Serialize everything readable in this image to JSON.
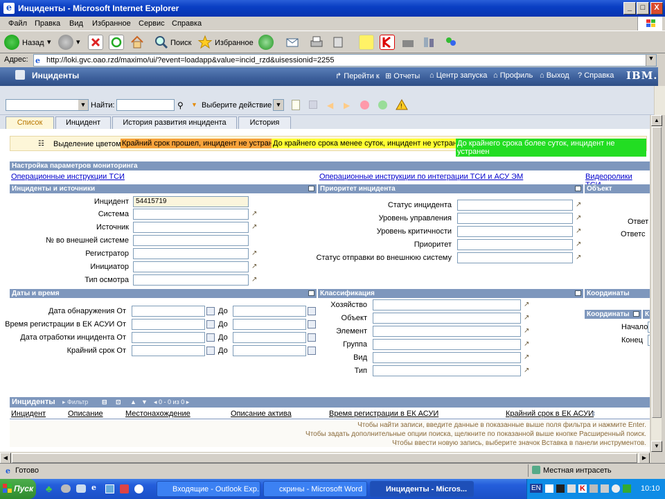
{
  "window": {
    "title": "Инциденты - Microsoft Internet Explorer",
    "min_label": "_",
    "max_label": "□",
    "close_label": "X"
  },
  "menu": [
    "Файл",
    "Правка",
    "Вид",
    "Избранное",
    "Сервис",
    "Справка"
  ],
  "toolbar": {
    "back": "Назад",
    "search": "Поиск",
    "favorites": "Избранное"
  },
  "address": {
    "label": "Адрес:",
    "url": "http://loki.gvc.oao.rzd/maximo/ui/?event=loadapp&value=incid_rzd&uisessionid=2255"
  },
  "maximo": {
    "app_title": "Инциденты",
    "links": [
      "Перейти к",
      "Отчеты",
      "Центр запуска",
      "Профиль",
      "Выход",
      "Справка"
    ],
    "brand": "IBM."
  },
  "mxtoolbar": {
    "find_label": "Найти:",
    "find_value": "",
    "action_label": "Выберите действие"
  },
  "tabs": [
    "Список",
    "Инцидент",
    "История развития инцидента",
    "История"
  ],
  "legend": {
    "label": "Выделение цветом:",
    "overdue": "Крайний срок прошел, инцидент не устранен",
    "less_day": "До крайнего срока менее суток, инцидент не устранен",
    "more_day": "До крайнего срока более суток, инцидент не устранен"
  },
  "monitor_header": "Настройка параметров мониторинга",
  "links": {
    "tsi": "Операционные инструкции ТСИ",
    "integration": "Операционные инструкции по интеграции ТСИ и АСУ ЭМ",
    "video": "Видеоролики ТСИ"
  },
  "sections": {
    "incidents_sources": "Инциденты и источники",
    "priority": "Приоритет инцидента",
    "object": "Объект",
    "dates": "Даты и время",
    "classification": "Классификация",
    "coords": "Координаты",
    "coords_sub": "Координаты",
    "coords_sub2": "К"
  },
  "fields_left": [
    {
      "label": "Инцидент",
      "value": "54415719"
    },
    {
      "label": "Система",
      "value": ""
    },
    {
      "label": "Источник",
      "value": ""
    },
    {
      "label": "№ во внешней системе",
      "value": ""
    },
    {
      "label": "Регистратор",
      "value": ""
    },
    {
      "label": "Инициатор",
      "value": ""
    },
    {
      "label": "Тип осмотра",
      "value": ""
    }
  ],
  "fields_mid": [
    {
      "label": "Статус инцидента"
    },
    {
      "label": "Уровень управления"
    },
    {
      "label": "Уровень критичности"
    },
    {
      "label": "Приоритет"
    },
    {
      "label": "Статус отправки во внешнюю систему"
    }
  ],
  "object_right": [
    "Ответ",
    "Ответс"
  ],
  "dates": [
    {
      "label": "Дата обнаружения От",
      "to": "До"
    },
    {
      "label": "Время регистрации в ЕК АСУИ От",
      "to": "До"
    },
    {
      "label": "Дата отработки инцидента От",
      "to": "До"
    },
    {
      "label": "Крайний срок От",
      "to": "До"
    }
  ],
  "classification": [
    "Хозяйство",
    "Объект",
    "Элемент",
    "Группа",
    "Вид",
    "Тип"
  ],
  "coords_fields": [
    "Начало",
    "Конец"
  ],
  "incidents_table": {
    "title": "Инциденты",
    "filter": "Фильтр",
    "pager": "0 - 0 из 0",
    "columns": [
      "Инцидент",
      "Описание",
      "Местонахождение",
      "Описание актива",
      "Время регистрации в ЕК АСУИ",
      "Крайний срок в ЕК АСУИ"
    ],
    "hints": [
      "Чтобы найти записи, введите данные в показанные выше поля фильтра и нажмите Enter.",
      "Чтобы задать дополнительные опции поиска, щелкните по показанной выше кнопке Расширенный поиск.",
      "Чтобы ввести новую запись, выберите значок Вставка в панели инструментов."
    ]
  },
  "status": {
    "left": "Готово",
    "zone": "Местная интрасеть"
  },
  "taskbar": {
    "start": "Пуск",
    "tasks": [
      "Входящие - Outlook Exp...",
      "скрины - Microsoft Word",
      "Инциденты - Micros..."
    ],
    "lang": "EN",
    "clock": "10:10"
  },
  "colors": {
    "overdue": "#f7a23a",
    "less_day": "#ffff33",
    "more_day": "#22dd22"
  }
}
